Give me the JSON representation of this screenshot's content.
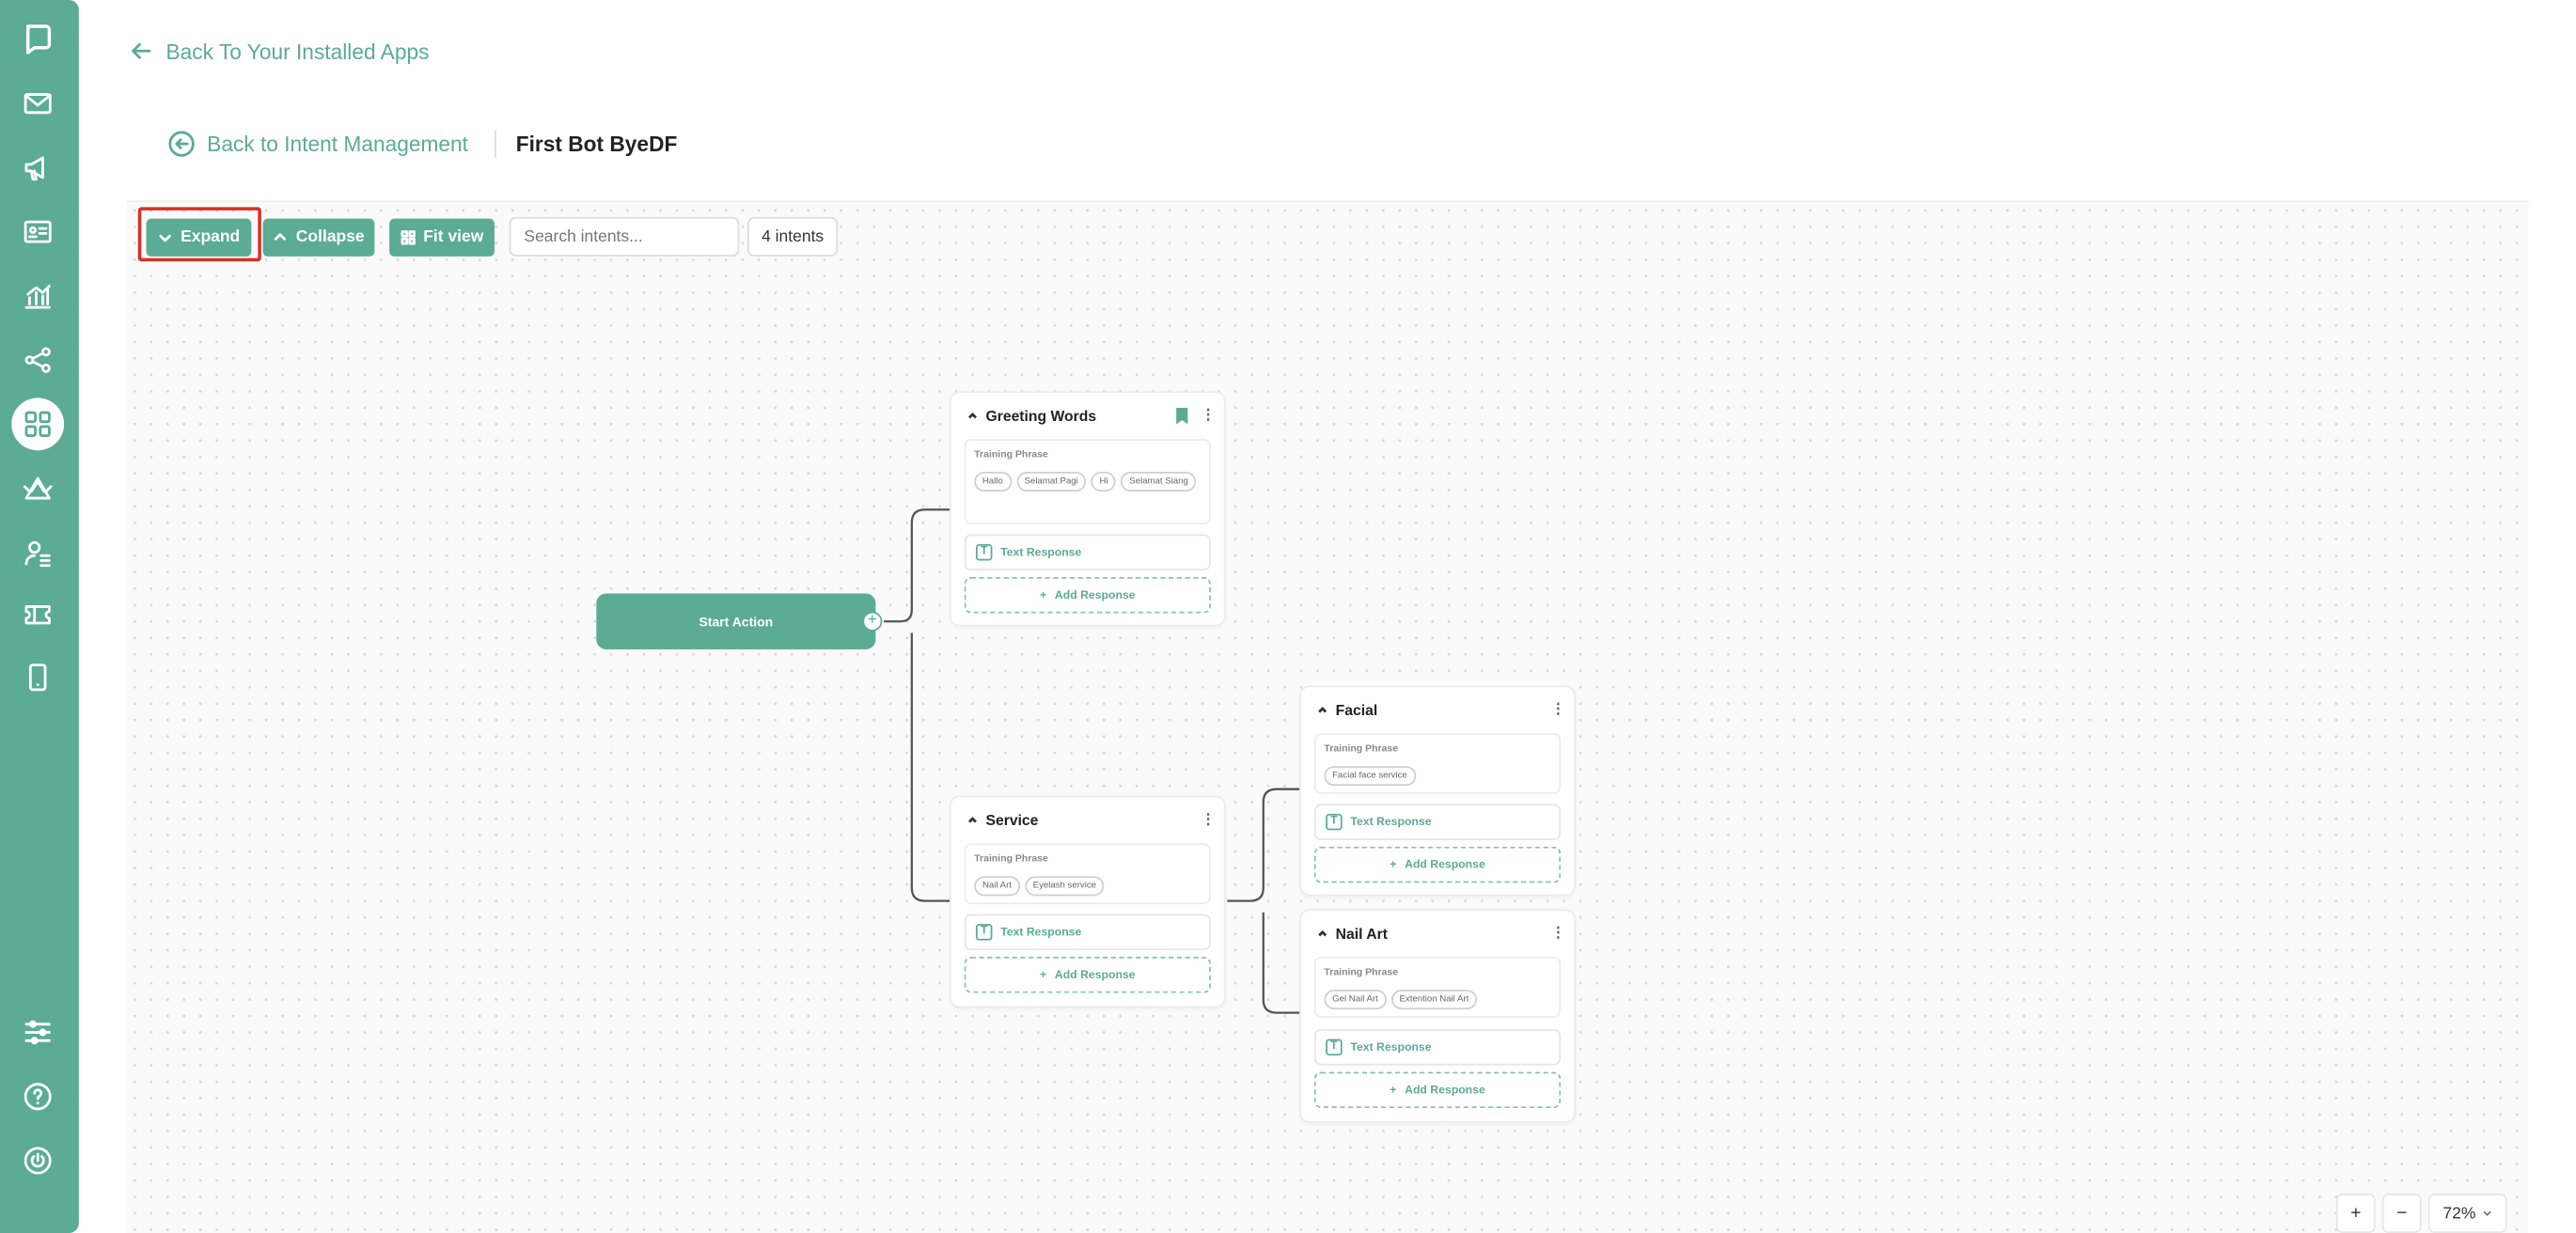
{
  "nav": {
    "back_apps": "Back To Your Installed Apps",
    "back_intent": "Back to Intent Management",
    "bot_name": "First Bot ByeDF"
  },
  "sidebar": {
    "icons": [
      "logo-icon",
      "mail-icon",
      "megaphone-icon",
      "contact-card-icon",
      "analytics-icon",
      "flow-share-icon",
      "apps-grid-icon",
      "broadcast-icon",
      "agent-icon",
      "ticket-icon",
      "mobile-icon",
      "settings-sliders-icon",
      "help-icon",
      "power-icon"
    ],
    "active": "apps-grid-icon"
  },
  "toolbar": {
    "expand": "Expand",
    "collapse": "Collapse",
    "fit_view": "Fit view",
    "search_placeholder": "Search intents...",
    "count": "4 intents"
  },
  "flow": {
    "start": "Start Action",
    "training_label": "Training Phrase",
    "text_response": "Text Response",
    "add_response": "Add Response",
    "intents": {
      "greeting": {
        "title": "Greeting Words",
        "phrases": [
          "Hallo",
          "Selamat Pagi",
          "Hi",
          "Selamat Siang"
        ]
      },
      "service": {
        "title": "Service",
        "phrases": [
          "Nail Art",
          "Eyelash service"
        ]
      },
      "facial": {
        "title": "Facial",
        "phrases": [
          "Facial face service"
        ]
      },
      "nailart": {
        "title": "Nail Art",
        "phrases": [
          "Gel Nail Art",
          "Extention Nail Art"
        ]
      }
    }
  },
  "zoom": {
    "plus": "+",
    "minus": "−",
    "level": "72%"
  },
  "colors": {
    "accent": "#5bab95",
    "highlight": "#d93025"
  }
}
